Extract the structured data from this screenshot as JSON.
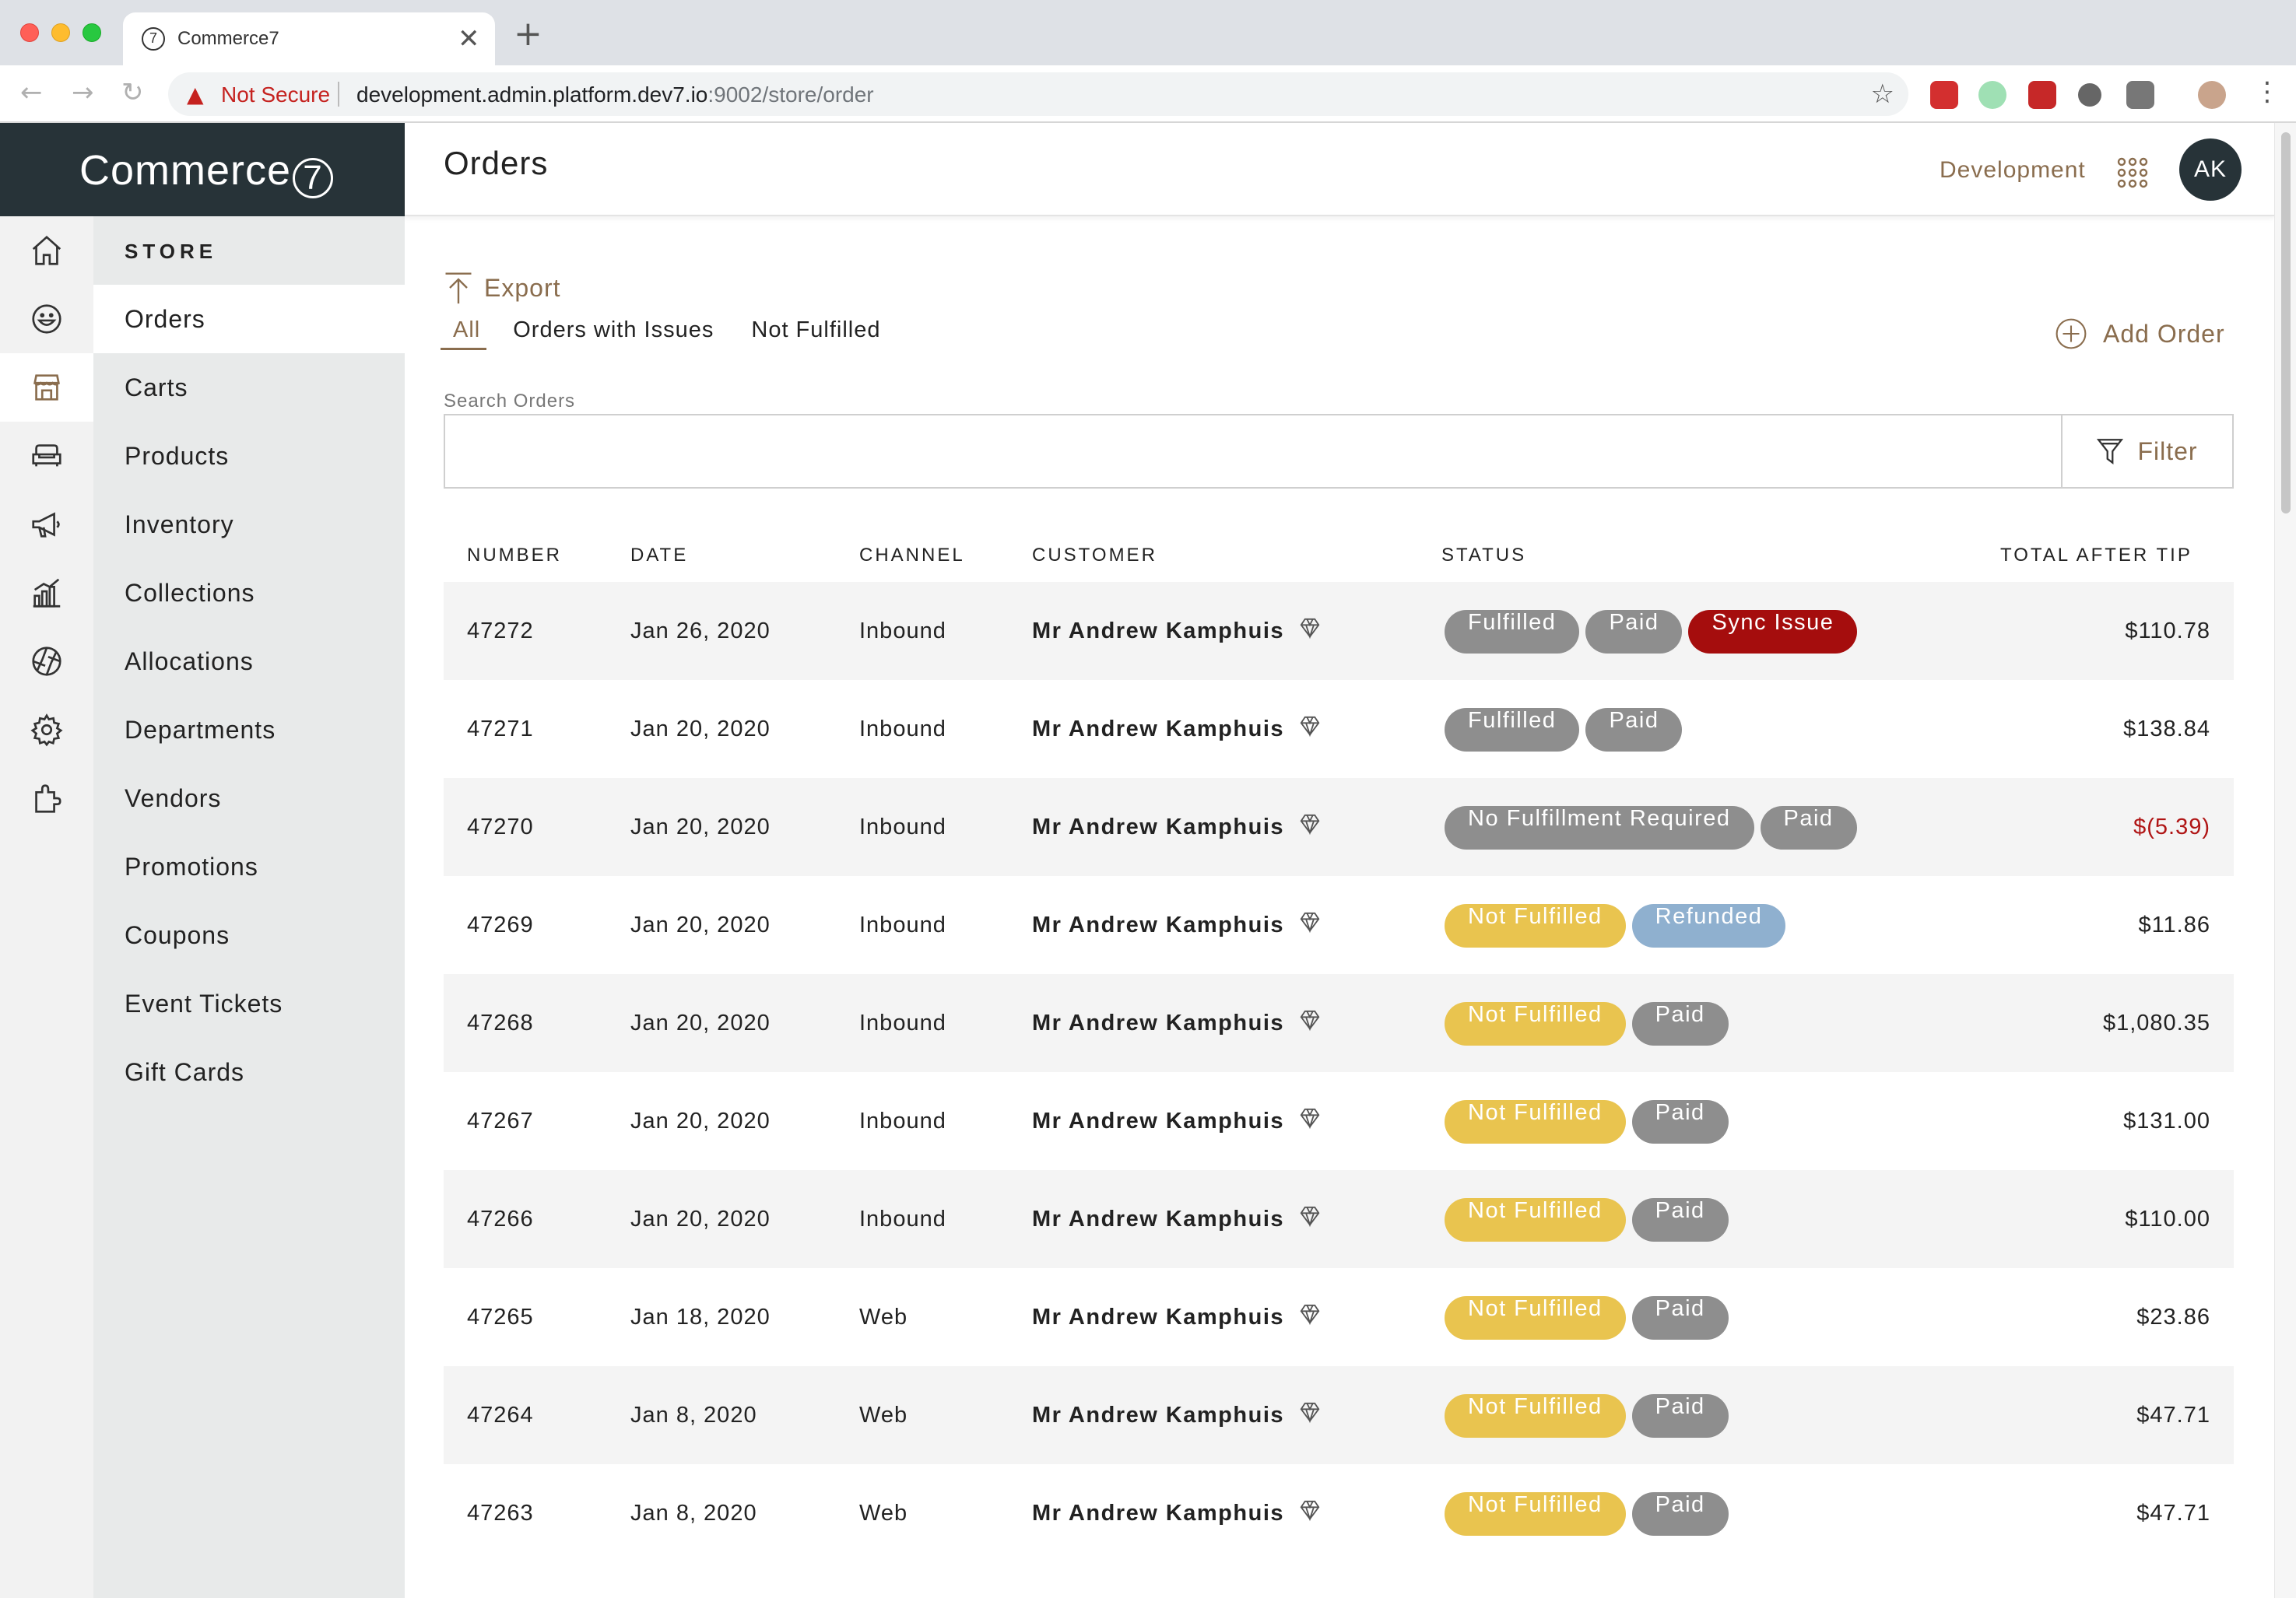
{
  "browser": {
    "tab_title": "Commerce7",
    "tab_favicon": "7",
    "close_symbol": "✕",
    "newtab_symbol": "+",
    "security_text": "Not Secure",
    "url_host": "development.admin.platform.dev7.io",
    "url_rest": ":9002/store/order"
  },
  "brand": {
    "name": "Commerce",
    "mark": "7"
  },
  "sidebar": {
    "section_title": "STORE",
    "items": [
      {
        "label": "Orders"
      },
      {
        "label": "Carts"
      },
      {
        "label": "Products"
      },
      {
        "label": "Inventory"
      },
      {
        "label": "Collections"
      },
      {
        "label": "Allocations"
      },
      {
        "label": "Departments"
      },
      {
        "label": "Vendors"
      },
      {
        "label": "Promotions"
      },
      {
        "label": "Coupons"
      },
      {
        "label": "Event Tickets"
      },
      {
        "label": "Gift Cards"
      }
    ],
    "rail_icons": [
      "home-icon",
      "smiley-icon",
      "store-icon",
      "sofa-icon",
      "megaphone-icon",
      "bar-chart-icon",
      "aperture-icon",
      "gear-icon",
      "puzzle-icon"
    ]
  },
  "header": {
    "title": "Orders",
    "environment": "Development",
    "avatar_initials": "AK"
  },
  "toolbar": {
    "export_label": "Export",
    "tabs": [
      {
        "label": "All"
      },
      {
        "label": "Orders with Issues"
      },
      {
        "label": "Not Fulfilled"
      }
    ],
    "add_order_label": "Add Order"
  },
  "search": {
    "label": "Search Orders",
    "value": "",
    "placeholder": "",
    "filter_label": "Filter"
  },
  "table": {
    "columns": [
      "NUMBER",
      "DATE",
      "CHANNEL",
      "CUSTOMER",
      "STATUS",
      "TOTAL AFTER TIP"
    ],
    "rows": [
      {
        "number": "47272",
        "date": "Jan 26, 2020",
        "channel": "Inbound",
        "customer": "Mr Andrew Kamphuis",
        "statuses": [
          "Fulfilled",
          "Paid",
          "Sync Issue"
        ],
        "total": "$110.78"
      },
      {
        "number": "47271",
        "date": "Jan 20, 2020",
        "channel": "Inbound",
        "customer": "Mr Andrew Kamphuis",
        "statuses": [
          "Fulfilled",
          "Paid"
        ],
        "total": "$138.84"
      },
      {
        "number": "47270",
        "date": "Jan 20, 2020",
        "channel": "Inbound",
        "customer": "Mr Andrew Kamphuis",
        "statuses": [
          "No Fulfillment Required",
          "Paid"
        ],
        "total": "$(5.39)"
      },
      {
        "number": "47269",
        "date": "Jan 20, 2020",
        "channel": "Inbound",
        "customer": "Mr Andrew Kamphuis",
        "statuses": [
          "Not Fulfilled",
          "Refunded"
        ],
        "total": "$11.86"
      },
      {
        "number": "47268",
        "date": "Jan 20, 2020",
        "channel": "Inbound",
        "customer": "Mr Andrew Kamphuis",
        "statuses": [
          "Not Fulfilled",
          "Paid"
        ],
        "total": "$1,080.35"
      },
      {
        "number": "47267",
        "date": "Jan 20, 2020",
        "channel": "Inbound",
        "customer": "Mr Andrew Kamphuis",
        "statuses": [
          "Not Fulfilled",
          "Paid"
        ],
        "total": "$131.00"
      },
      {
        "number": "47266",
        "date": "Jan 20, 2020",
        "channel": "Inbound",
        "customer": "Mr Andrew Kamphuis",
        "statuses": [
          "Not Fulfilled",
          "Paid"
        ],
        "total": "$110.00"
      },
      {
        "number": "47265",
        "date": "Jan 18, 2020",
        "channel": "Web",
        "customer": "Mr Andrew Kamphuis",
        "statuses": [
          "Not Fulfilled",
          "Paid"
        ],
        "total": "$23.86"
      },
      {
        "number": "47264",
        "date": "Jan 8, 2020",
        "channel": "Web",
        "customer": "Mr Andrew Kamphuis",
        "statuses": [
          "Not Fulfilled",
          "Paid"
        ],
        "total": "$47.71"
      },
      {
        "number": "47263",
        "date": "Jan 8, 2020",
        "channel": "Web",
        "customer": "Mr Andrew Kamphuis",
        "statuses": [
          "Not Fulfilled",
          "Paid"
        ],
        "total": "$47.71"
      }
    ]
  },
  "status_colors": {
    "Fulfilled": "#8e8e8e",
    "Paid": "#8e8e8e",
    "Sync Issue": "#a50d0d",
    "No Fulfillment Required": "#8e8e8e",
    "Not Fulfilled": "#e9c44f",
    "Refunded": "#8fb0cf"
  },
  "colors": {
    "accent": "#8a6d4e",
    "brand_dark": "#273338",
    "negative": "#b01515"
  }
}
